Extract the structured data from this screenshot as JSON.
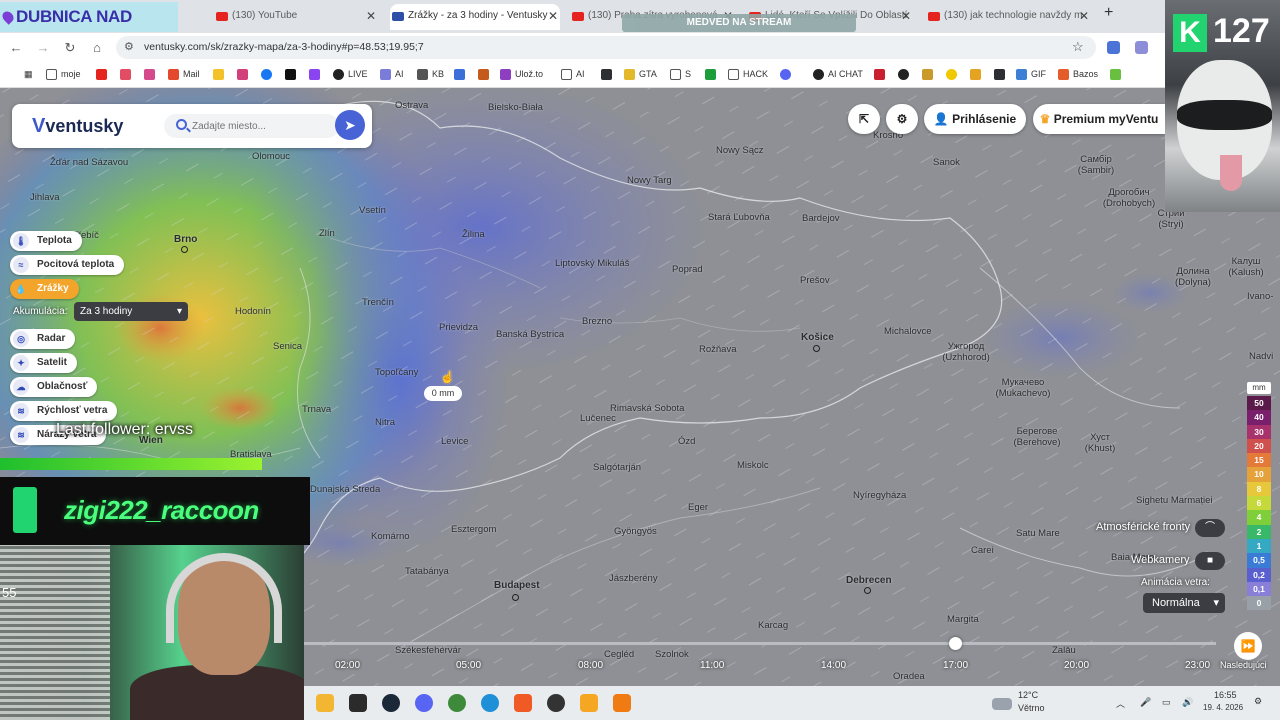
{
  "stream": {
    "title": "DUBNICA NAD VÁHOM",
    "follower_text": "Last follower: ervss",
    "channel_name": "zigi222_raccoon",
    "counter": "127",
    "webcam_number": "55",
    "medved_label": "MEDVED NA STREAM"
  },
  "browser": {
    "tabs": [
      {
        "label": "(130) YouTube"
      },
      {
        "label": "Zrážky - za 3 hodiny - Ventusky"
      },
      {
        "label": "(130) Praha zítra vyrobenová"
      },
      {
        "label": "Lidé, Kteří Se Vplížili Do Oblastí"
      },
      {
        "label": "(130) jak technologie navždy m"
      }
    ],
    "url": "ventusky.com/sk/zrazky-mapa/za-3-hodiny#p=48.53;19.95;7",
    "bookmarks": [
      "moje",
      "Mail",
      "LIVE",
      "AI",
      "KB",
      "Ulož.to",
      "AI",
      "GTA",
      "S",
      "HACK",
      "AI CHAT",
      "GIF",
      "Bazos"
    ]
  },
  "app": {
    "logo": "ventusky",
    "search_placeholder": "Zadajte miesto...",
    "login_label": "Prihlásenie",
    "premium_label": "Premium  myVentu",
    "layers": [
      {
        "label": "Teplota",
        "icon": "thermometer-icon"
      },
      {
        "label": "Pocitová teplota",
        "icon": "feels-like-icon"
      },
      {
        "label": "Zrážky",
        "icon": "drop-icon",
        "active": true
      },
      {
        "label": "Radar",
        "icon": "radar-icon"
      },
      {
        "label": "Satelit",
        "icon": "satellite-icon"
      },
      {
        "label": "Oblačnosť",
        "icon": "cloud-icon"
      },
      {
        "label": "Rýchlosť vetra",
        "icon": "wind-icon"
      },
      {
        "label": "Nárazy vetra",
        "icon": "gust-icon"
      }
    ],
    "accumulation_label": "Akumulácia:",
    "accumulation_value": "Za 3 hodiny",
    "tooltip_value": "0 mm",
    "fronts_label": "Atmosférické fronty",
    "webcams_label": "Webkamery",
    "wind_anim_label": "Animácia vetra:",
    "wind_anim_value": "Normálna",
    "next_label": "Nasledujúci"
  },
  "legend": {
    "unit": "mm",
    "values": [
      "50",
      "40",
      "30",
      "20",
      "15",
      "10",
      "8",
      "6",
      "4",
      "2",
      "1",
      "0,5",
      "0,2",
      "0,1",
      "0"
    ],
    "colors": [
      "#5a1a4a",
      "#7a1f6b",
      "#a8326b",
      "#d0504d",
      "#e47a3a",
      "#e6a23a",
      "#e6c83a",
      "#c6d93a",
      "#7fcf3a",
      "#3ab86a",
      "#35a9c4",
      "#3a7bd6",
      "#5a5fd0",
      "#8a7fd8",
      "#9aa0a8"
    ]
  },
  "timeline": {
    "times": [
      "02:00",
      "05:00",
      "08:00",
      "11:00",
      "14:00",
      "17:00",
      "20:00",
      "23:00"
    ],
    "current_time": "17:00"
  },
  "cities": [
    {
      "name": "Ostrava"
    },
    {
      "name": "Bielsko-Biała"
    },
    {
      "name": "Žďár nad Sázavou"
    },
    {
      "name": "Olomouc"
    },
    {
      "name": "Jihlava"
    },
    {
      "name": "Zlín"
    },
    {
      "name": "Vsetín"
    },
    {
      "name": "Třebíč"
    },
    {
      "name": "Brno",
      "big": true
    },
    {
      "name": "Žilina"
    },
    {
      "name": "Nowy Sącz"
    },
    {
      "name": "Nowy Targ"
    },
    {
      "name": "Krosno"
    },
    {
      "name": "Sanok"
    },
    {
      "name": "Самбір (Sambir)"
    },
    {
      "name": "Дрогобич (Drohobych)"
    },
    {
      "name": "Стрий (Stryi)"
    },
    {
      "name": "Stará Ľubovňa"
    },
    {
      "name": "Bardejov"
    },
    {
      "name": "Liptovský Mikuláš"
    },
    {
      "name": "Poprad"
    },
    {
      "name": "Prešov"
    },
    {
      "name": "Hodonín"
    },
    {
      "name": "Trenčín"
    },
    {
      "name": "Prievidza"
    },
    {
      "name": "Banská Bystrica"
    },
    {
      "name": "Brezno"
    },
    {
      "name": "Senica"
    },
    {
      "name": "Rožňava"
    },
    {
      "name": "Košice",
      "big": true
    },
    {
      "name": "Michalovce"
    },
    {
      "name": "Ужгород (Uzhhorod)"
    },
    {
      "name": "Долина (Dolyna)"
    },
    {
      "name": "Калуш (Kalush)"
    },
    {
      "name": "Topoľčany"
    },
    {
      "name": "Rimavská Sobota"
    },
    {
      "name": "Lučenec"
    },
    {
      "name": "Мукачево (Mukachevo)"
    },
    {
      "name": "Trnava"
    },
    {
      "name": "Nitra"
    },
    {
      "name": "Levice"
    },
    {
      "name": "Ózd"
    },
    {
      "name": "Берегове (Berehove)"
    },
    {
      "name": "Хуст (Khust)"
    },
    {
      "name": "Wien",
      "big": true
    },
    {
      "name": "Bratislava"
    },
    {
      "name": "Salgótarján"
    },
    {
      "name": "Miskolc"
    },
    {
      "name": "Nyíregyháza"
    },
    {
      "name": "Dunajská Streda"
    },
    {
      "name": "Eger"
    },
    {
      "name": "Sighetu Marmației"
    },
    {
      "name": "Esztergom"
    },
    {
      "name": "Komárno"
    },
    {
      "name": "Gyöngyös"
    },
    {
      "name": "Satu Mare"
    },
    {
      "name": "Carei"
    },
    {
      "name": "Tatabánya"
    },
    {
      "name": "Budapest",
      "big": true
    },
    {
      "name": "Jászberény"
    },
    {
      "name": "Debrecen",
      "big": true
    },
    {
      "name": "Baia Mare"
    },
    {
      "name": "Margita"
    },
    {
      "name": "Székesfehérvár"
    },
    {
      "name": "Cegléd"
    },
    {
      "name": "Szolnok"
    },
    {
      "name": "Karcag"
    },
    {
      "name": "Zalău"
    },
    {
      "name": "Oradea"
    },
    {
      "name": "Ivano-"
    },
    {
      "name": "Nadvi"
    }
  ],
  "taskbar": {
    "temperature": "12°C",
    "weather": "Větrno",
    "time": "16:55",
    "date": "19. 4. 2026"
  }
}
